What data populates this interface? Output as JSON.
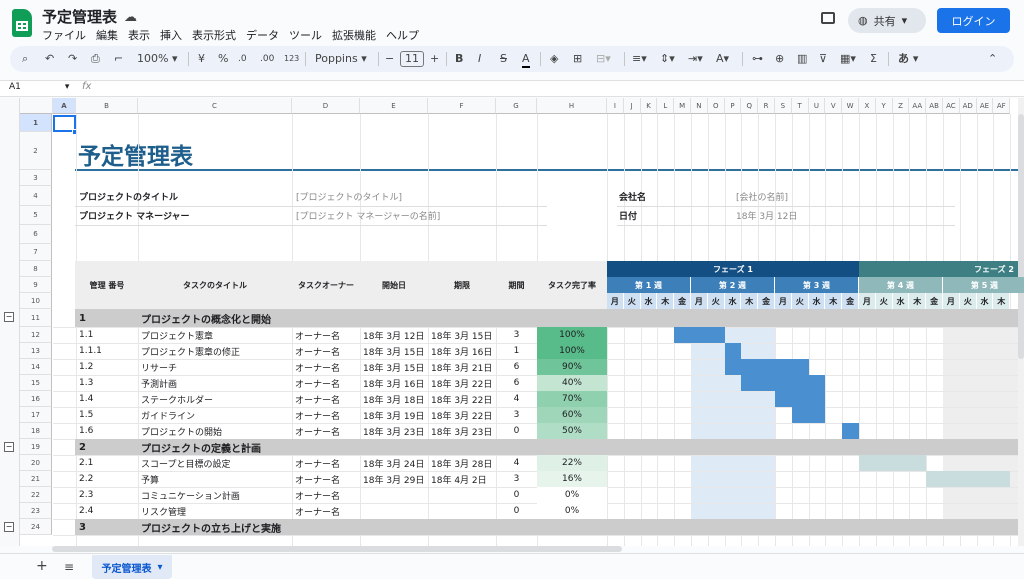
{
  "app": {
    "doc_title": "予定管理表",
    "share_label": "共有",
    "login_label": "ログイン",
    "menu": [
      "ファイル",
      "編集",
      "表示",
      "挿入",
      "表示形式",
      "データ",
      "ツール",
      "拡張機能",
      "ヘルプ"
    ]
  },
  "toolbar": {
    "zoom": "100%",
    "currency": "¥",
    "percent": "%",
    "dec_minus": ".0",
    "dec_plus": ".00",
    "fmt123": "123",
    "font": "Poppins",
    "font_size": "11"
  },
  "formula": {
    "namebox": "A1",
    "fx": "fx"
  },
  "columns": [
    "A",
    "B",
    "C",
    "D",
    "E",
    "F",
    "G",
    "H",
    "I",
    "J",
    "K",
    "L",
    "M",
    "N",
    "O",
    "P",
    "Q",
    "R",
    "S",
    "T",
    "U",
    "V",
    "W",
    "X",
    "Y",
    "Z",
    "AA",
    "AB",
    "AC",
    "AD",
    "AE",
    "AF"
  ],
  "rows": [
    "1",
    "2",
    "3",
    "4",
    "5",
    "6",
    "7",
    "8",
    "9",
    "10",
    "11",
    "12",
    "13",
    "14",
    "15",
    "16",
    "17",
    "18",
    "19",
    "20",
    "21",
    "22",
    "23",
    "24"
  ],
  "sheet": {
    "title": "予定管理表",
    "project_title_label": "プロジェクトのタイトル",
    "project_title_value": "[プロジェクトのタイトル]",
    "pm_label": "プロジェクト マネージャー",
    "pm_value": "[プロジェクト マネージャーの名前]",
    "company_label": "会社名",
    "company_value": "[会社の名前]",
    "date_label": "日付",
    "date_value": "18年 3月 12日",
    "headers": {
      "id": "管理 番号",
      "task": "タスクのタイトル",
      "owner": "タスクオーナー",
      "start": "開始日",
      "end": "期限",
      "duration": "期間",
      "done": "タスク完了率"
    },
    "phase1": "フェーズ 1",
    "phase2": "フェーズ 2",
    "weeks": [
      "第 1 週",
      "第 2 週",
      "第 3 週",
      "第 4 週",
      "第 5 週"
    ],
    "days": [
      "月",
      "火",
      "水",
      "木",
      "金"
    ],
    "tasks": [
      {
        "type": "group",
        "id": "1",
        "task": "プロジェクトの概念化と開始"
      },
      {
        "id": "1.1",
        "task": "プロジェクト憲章",
        "owner": "オーナー名",
        "start": "18年 3月 12日",
        "end": "18年 3月 15日",
        "duration": "3",
        "done": "100%",
        "pct": 1.0
      },
      {
        "id": "1.1.1",
        "task": "プロジェクト憲章の修正",
        "owner": "オーナー名",
        "start": "18年 3月 15日",
        "end": "18年 3月 16日",
        "duration": "1",
        "done": "100%",
        "pct": 1.0
      },
      {
        "id": "1.2",
        "task": "リサーチ",
        "owner": "オーナー名",
        "start": "18年 3月 15日",
        "end": "18年 3月 21日",
        "duration": "6",
        "done": "90%",
        "pct": 0.9
      },
      {
        "id": "1.3",
        "task": "予測計画",
        "owner": "オーナー名",
        "start": "18年 3月 16日",
        "end": "18年 3月 22日",
        "duration": "6",
        "done": "40%",
        "pct": 0.4
      },
      {
        "id": "1.4",
        "task": "ステークホルダー",
        "owner": "オーナー名",
        "start": "18年 3月 18日",
        "end": "18年 3月 22日",
        "duration": "4",
        "done": "70%",
        "pct": 0.7
      },
      {
        "id": "1.5",
        "task": "ガイドライン",
        "owner": "オーナー名",
        "start": "18年 3月 19日",
        "end": "18年 3月 22日",
        "duration": "3",
        "done": "60%",
        "pct": 0.6
      },
      {
        "id": "1.6",
        "task": "プロジェクトの開始",
        "owner": "オーナー名",
        "start": "18年 3月 23日",
        "end": "18年 3月 23日",
        "duration": "0",
        "done": "50%",
        "pct": 0.5
      },
      {
        "type": "group",
        "id": "2",
        "task": "プロジェクトの定義と計画"
      },
      {
        "id": "2.1",
        "task": "スコープと目標の設定",
        "owner": "オーナー名",
        "start": "18年 3月 24日",
        "end": "18年 3月 28日",
        "duration": "4",
        "done": "22%",
        "pct": 0.22
      },
      {
        "id": "2.2",
        "task": "予算",
        "owner": "オーナー名",
        "start": "18年 3月 29日",
        "end": "18年 4月 2日",
        "duration": "3",
        "done": "16%",
        "pct": 0.16
      },
      {
        "id": "2.3",
        "task": "コミュニケーション計画",
        "owner": "オーナー名",
        "start": "",
        "end": "",
        "duration": "0",
        "done": "0%",
        "pct": 0
      },
      {
        "id": "2.4",
        "task": "リスク管理",
        "owner": "オーナー名",
        "start": "",
        "end": "",
        "duration": "0",
        "done": "0%",
        "pct": 0
      },
      {
        "type": "group",
        "id": "3",
        "task": "プロジェクトの立ち上げと実施"
      }
    ]
  },
  "tabs": {
    "active": "予定管理表"
  }
}
